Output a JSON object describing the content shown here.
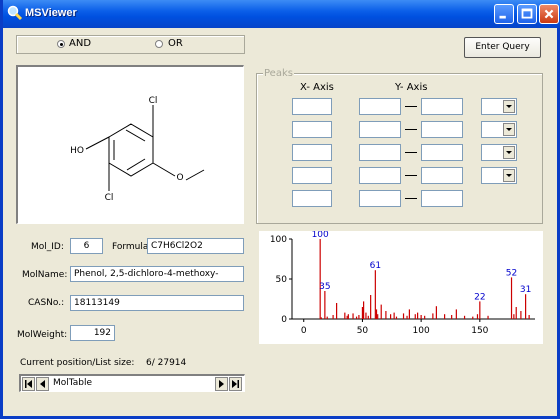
{
  "window": {
    "title": "MSViewer"
  },
  "query": {
    "and_label": "AND",
    "or_label": "OR",
    "selected": "AND",
    "enter_label": "Enter Query"
  },
  "molecule": {
    "atoms": {
      "cl1": "Cl",
      "cl2": "Cl",
      "ho": "HO",
      "o": "O"
    }
  },
  "peaks": {
    "legend": "Peaks",
    "x_header": "X- Axis",
    "y_header": "Y- Axis"
  },
  "fields": {
    "molid_label": "Mol_ID:",
    "molid_value": "6",
    "formula_label": "Formula:",
    "formula_value": "C7H6Cl2O2",
    "molname_label": "MolName:",
    "molname_value": "Phenol, 2,5-dichloro-4-methoxy-",
    "casno_label": "CASNo.:",
    "casno_value": "18113149",
    "molweight_label": "MolWeight:",
    "molweight_value": "192"
  },
  "status": {
    "position_label": "Current position/List size:",
    "position_value": "6/ 27914"
  },
  "navigator": {
    "table_name": "MolTable"
  },
  "chart_data": {
    "type": "bar",
    "xlim": [
      -10,
      197
    ],
    "ylim": [
      0,
      100
    ],
    "xticks": [
      0,
      50,
      100,
      150
    ],
    "yticks": [
      0,
      50,
      100
    ],
    "bar_color": "#cc0000",
    "label_color": "#0000cc",
    "x": [
      14,
      15,
      18,
      20,
      25,
      28,
      35,
      37,
      38,
      42,
      45,
      47,
      50,
      51,
      53,
      55,
      57,
      61,
      62,
      63,
      66,
      70,
      74,
      77,
      79,
      85,
      88,
      90,
      95,
      97,
      100,
      103,
      110,
      113,
      120,
      126,
      130,
      137,
      144,
      148,
      150,
      157,
      177,
      179,
      181,
      185,
      189,
      192
    ],
    "values": [
      100,
      2,
      35,
      3,
      5,
      20,
      8,
      4,
      6,
      7,
      3,
      5,
      15,
      22,
      8,
      4,
      30,
      61,
      12,
      6,
      18,
      10,
      6,
      8,
      3,
      7,
      4,
      12,
      6,
      8,
      5,
      4,
      7,
      16,
      6,
      5,
      12,
      4,
      3,
      6,
      22,
      4,
      52,
      6,
      15,
      10,
      31,
      5
    ],
    "labels": [
      {
        "x": 14,
        "y": 100,
        "text": "100"
      },
      {
        "x": 18,
        "y": 35,
        "text": "35"
      },
      {
        "x": 61,
        "y": 61,
        "text": "61"
      },
      {
        "x": 150,
        "y": 22,
        "text": "22"
      },
      {
        "x": 177,
        "y": 52,
        "text": "52"
      },
      {
        "x": 189,
        "y": 31,
        "text": "31"
      }
    ]
  }
}
